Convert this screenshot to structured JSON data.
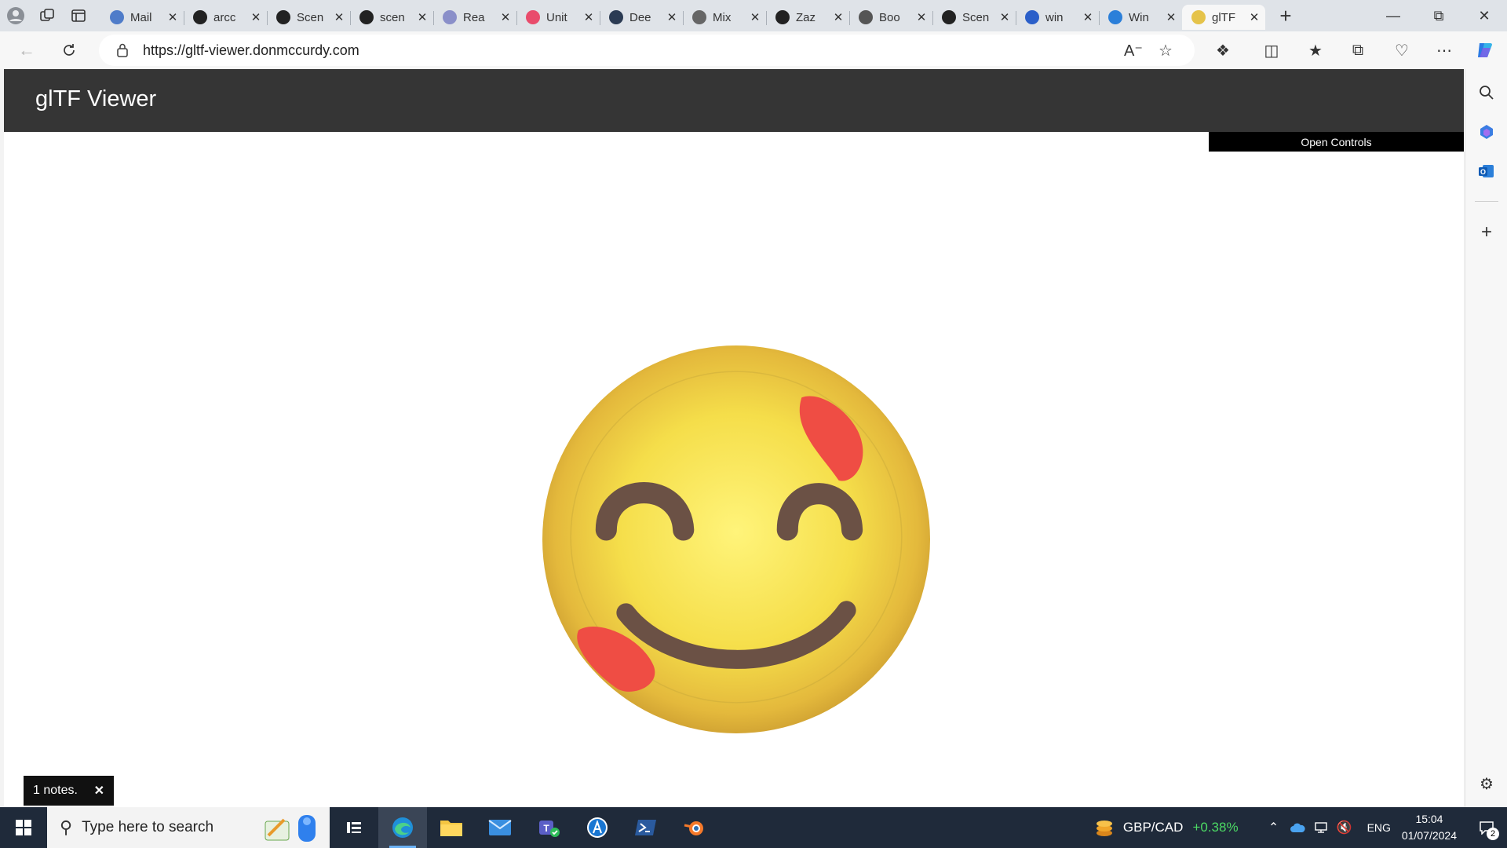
{
  "browser": {
    "tabs": [
      {
        "title": "Mail",
        "icon": "outlook-icon",
        "color": "#4f7cc9"
      },
      {
        "title": "arcc",
        "icon": "github-icon",
        "color": "#222222"
      },
      {
        "title": "Scen",
        "icon": "github-icon",
        "color": "#222222"
      },
      {
        "title": "scen",
        "icon": "github-icon",
        "color": "#222222"
      },
      {
        "title": "Rea",
        "icon": "react-icon",
        "color": "#8a8fc9"
      },
      {
        "title": "Unit",
        "icon": "youtube-icon",
        "color": "#e94c6c"
      },
      {
        "title": "Dee",
        "icon": "deepl-icon",
        "color": "#2b3b53"
      },
      {
        "title": "Mix",
        "icon": "openai-icon",
        "color": "#666666"
      },
      {
        "title": "Zaz",
        "icon": "github-icon",
        "color": "#222222"
      },
      {
        "title": "Boo",
        "icon": "document-icon",
        "color": "#555555"
      },
      {
        "title": "Scen",
        "icon": "github-icon",
        "color": "#222222"
      },
      {
        "title": "win",
        "icon": "search-icon",
        "color": "#2b5fc9"
      },
      {
        "title": "Win",
        "icon": "calendar-icon",
        "color": "#2b7fd9"
      },
      {
        "title": "glTF",
        "icon": "emoji-icon",
        "color": "#e5c34a",
        "active": true
      }
    ],
    "url_host": "https://gltf-viewer.donmccurdy.com",
    "accent": "#0f6cbd"
  },
  "page": {
    "title": "glTF Viewer",
    "open_controls": "Open Controls",
    "notes": "1 notes.",
    "header_color": "#353535",
    "model": "smiling-face-emoji"
  },
  "taskbar": {
    "search_placeholder": "Type here to search",
    "ticker_symbol": "GBP/CAD",
    "ticker_change": "+0.38%",
    "language": "ENG",
    "time": "15:04",
    "date": "01/07/2024",
    "notifications": "2"
  }
}
